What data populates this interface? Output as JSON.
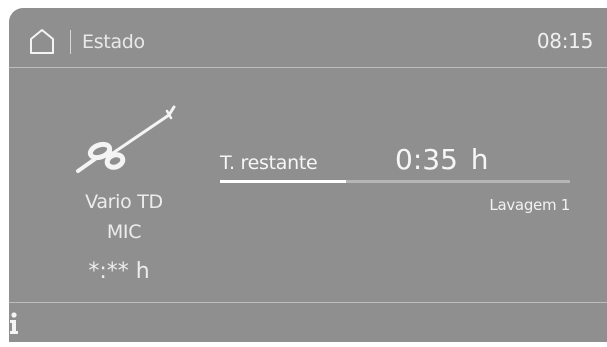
{
  "header": {
    "home_icon": "home-icon",
    "title": "Estado",
    "time": "08:15"
  },
  "program": {
    "icon": "instrument-icon",
    "name": "Vario TD",
    "subtitle": "MIC",
    "value": "*:** h"
  },
  "remaining": {
    "label": "T. restante",
    "value": "0:35 h",
    "progress": 0.36,
    "phase": "Lavagem 1"
  },
  "footer": {
    "info_icon": "info-icon"
  },
  "colors": {
    "background": "#8f8f8f",
    "text": "#f4f4f4",
    "progress_fill": "#ffffff",
    "progress_track": "#b5b5b5",
    "divider": "#bdbdbd"
  }
}
